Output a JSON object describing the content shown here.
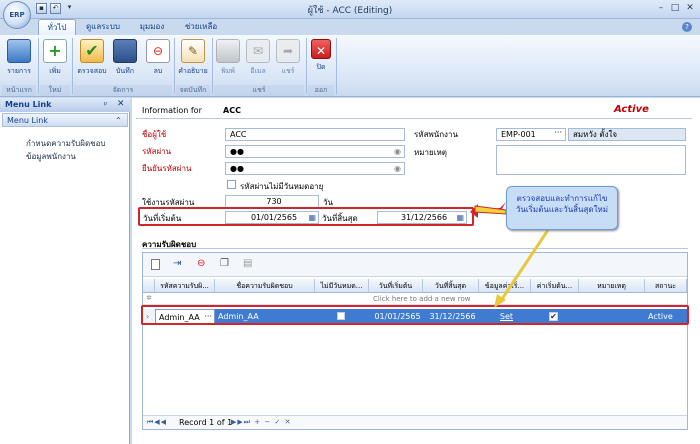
{
  "app": {
    "logo": "ERP",
    "title": "ผู้ใช้ - ACC (Editing)"
  },
  "tabs": [
    "ทั่วไป",
    "ดูแลระบบ",
    "มุมมอง",
    "ช่วยเหลือ"
  ],
  "ribbon": {
    "buttons": [
      {
        "label": "รายการ",
        "icon": "list-icon"
      },
      {
        "label": "เพิ่ม",
        "icon": "add-icon"
      },
      {
        "label": "ตรวจสอบ",
        "icon": "check-icon"
      },
      {
        "label": "บันทึก",
        "icon": "save-icon"
      },
      {
        "label": "ลบ",
        "icon": "delete-icon"
      },
      {
        "label": "คำอธิบาย",
        "icon": "description-icon"
      },
      {
        "label": "พิมพ์",
        "icon": "print-icon"
      },
      {
        "label": "อีเมล",
        "icon": "email-icon"
      },
      {
        "label": "แชร์",
        "icon": "share-icon"
      },
      {
        "label": "ปิด",
        "icon": "close-icon"
      }
    ],
    "groups": [
      "หน้าแรก",
      "ใหม่",
      "จัดการ",
      "จดบันทึก",
      "แชร์",
      "ออก"
    ]
  },
  "menu": {
    "title": "Menu Link",
    "pin": "ᵖ",
    "close": "✕",
    "section": "Menu Link",
    "items": [
      "กำหนดความรับผิดชอบ",
      "ข้อมูลพนักงาน"
    ]
  },
  "form": {
    "info_label": "Information for",
    "info_value": "ACC",
    "status": "Active",
    "username_label": "ชื่อผู้ใช้",
    "username": "ACC",
    "password_label": "รหัสผ่าน",
    "password": "●●",
    "confirm_label": "ยืนยันรหัสผ่าน",
    "confirm": "●●",
    "employee_code_label": "รหัสพนักงาน",
    "employee_code": "EMP-001",
    "employee_name": "สมหวัง ตั้งใจ",
    "note_label": "หมายเหตุ",
    "no_expire_label": "รหัสผ่านไม่มีวันหมดอายุ",
    "days_label": "ใช้งานรหัสผ่าน",
    "days": "730",
    "days_unit": "วัน",
    "start_label": "วันที่เริ่มต้น",
    "start_date": "01/01/2565",
    "end_label": "วันที่สิ้นสุด",
    "end_date": "31/12/2566",
    "section_title": "ความรับผิดชอบ"
  },
  "callout": {
    "line1": "ตรวจสอบและทำการแก้ไข",
    "line2": "วันเริ่มต้นและวันสิ้นสุดใหม่"
  },
  "grid": {
    "columns": [
      "รหัสความรับผิ...",
      "ชื่อความรับผิดชอบ",
      "ไม่มีวันหมด...",
      "วันที่เริ่มต้น",
      "วันที่สิ้นสุด",
      "ข้อมูลค่าเริ่...",
      "ค่าเริ่มต้น...",
      "หมายเหตุ",
      "สถานะ"
    ],
    "new_row": "Click here to add a new row",
    "row": {
      "code": "Admin_AA",
      "name": "Admin_AA",
      "no_expire": false,
      "start": "01/01/2565",
      "end": "31/12/2566",
      "default_data": "Set",
      "default": true,
      "note": "",
      "status": "Active"
    },
    "nav": "Record 1 of 1"
  }
}
